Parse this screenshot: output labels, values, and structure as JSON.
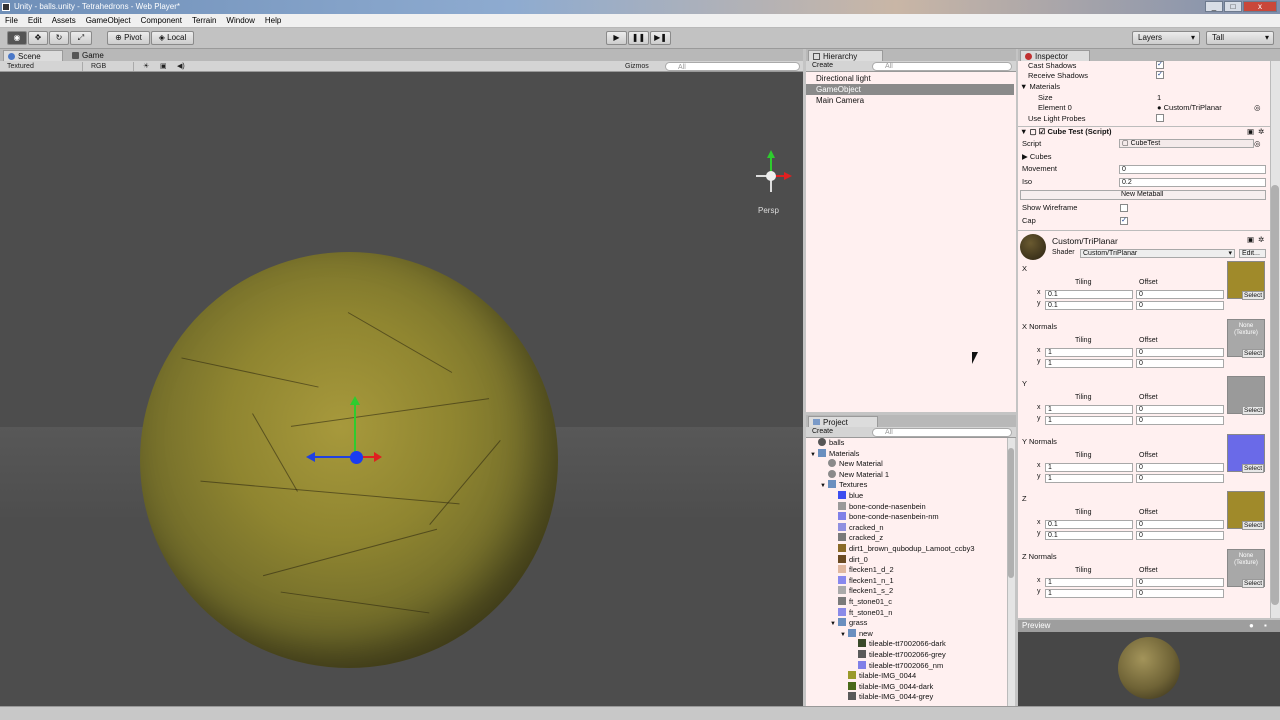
{
  "window": {
    "title": "Unity - balls.unity - Tetrahedrons - Web Player*"
  },
  "menu": [
    "File",
    "Edit",
    "Assets",
    "GameObject",
    "Component",
    "Terrain",
    "Window",
    "Help"
  ],
  "toolbar": {
    "pivot": "Pivot",
    "local": "Local",
    "layers": "Layers",
    "layout": "Tall"
  },
  "scene": {
    "tab_scene": "Scene",
    "tab_game": "Game",
    "render_mode": "Textured",
    "color_mode": "RGB",
    "gizmos": "Gizmos",
    "search": "All",
    "persp": "Persp"
  },
  "hierarchy": {
    "title": "Hierarchy",
    "create": "Create",
    "search": "All",
    "items": [
      "Directional light",
      "GameObject",
      "Main Camera"
    ],
    "selected_index": 1
  },
  "project": {
    "title": "Project",
    "create": "Create",
    "search": "All",
    "rows": [
      {
        "label": "balls",
        "indent": 0,
        "icon": "unity-scene-icon",
        "color": "#555555"
      },
      {
        "label": "Materials",
        "indent": 0,
        "icon": "folder-icon",
        "color": "#6a8fbf",
        "arrow": "▼"
      },
      {
        "label": "New Material",
        "indent": 1,
        "icon": "material-icon",
        "color": "#8a8a8a"
      },
      {
        "label": "New Material 1",
        "indent": 1,
        "icon": "material-icon",
        "color": "#8a8a8a"
      },
      {
        "label": "Textures",
        "indent": 1,
        "icon": "folder-icon",
        "color": "#6a8fbf",
        "arrow": "▼"
      },
      {
        "label": "blue",
        "indent": 2,
        "icon": "texture-icon",
        "color": "#3d4ef0"
      },
      {
        "label": "bone-conde-nasenbein",
        "indent": 2,
        "icon": "texture-icon",
        "color": "#9a9a9a"
      },
      {
        "label": "bone-conde-nasenbein-nm",
        "indent": 2,
        "icon": "texture-icon",
        "color": "#8080e8"
      },
      {
        "label": "cracked_n",
        "indent": 2,
        "icon": "texture-icon",
        "color": "#9090e0"
      },
      {
        "label": "cracked_z",
        "indent": 2,
        "icon": "texture-icon",
        "color": "#7a7a7a"
      },
      {
        "label": "dirt1_brown_qubodup_Lamoot_ccby3",
        "indent": 2,
        "icon": "texture-icon",
        "color": "#8a6a28"
      },
      {
        "label": "dirt_0",
        "indent": 2,
        "icon": "texture-icon",
        "color": "#6a4a22"
      },
      {
        "label": "flecken1_d_2",
        "indent": 2,
        "icon": "texture-icon",
        "color": "#e0b8a0"
      },
      {
        "label": "flecken1_n_1",
        "indent": 2,
        "icon": "texture-icon",
        "color": "#8888ee"
      },
      {
        "label": "flecken1_s_2",
        "indent": 2,
        "icon": "texture-icon",
        "color": "#aaaaaa"
      },
      {
        "label": "ft_stone01_c",
        "indent": 2,
        "icon": "texture-icon",
        "color": "#7a7a7a"
      },
      {
        "label": "ft_stone01_n",
        "indent": 2,
        "icon": "texture-icon",
        "color": "#8a8ae8"
      },
      {
        "label": "grass",
        "indent": 2,
        "icon": "folder-icon",
        "color": "#6a8fbf",
        "arrow": "▼"
      },
      {
        "label": "new",
        "indent": 3,
        "icon": "folder-icon",
        "color": "#6a8fbf",
        "arrow": "▼"
      },
      {
        "label": "tileable-tt7002066-dark",
        "indent": 4,
        "icon": "texture-icon",
        "color": "#3a4a2a"
      },
      {
        "label": "tileable-tt7002066-grey",
        "indent": 4,
        "icon": "texture-icon",
        "color": "#5a5a5a"
      },
      {
        "label": "tileable-tt7002066_nm",
        "indent": 4,
        "icon": "texture-icon",
        "color": "#8080e8"
      },
      {
        "label": "tilable-IMG_0044",
        "indent": 3,
        "icon": "texture-icon",
        "color": "#9a9a2a"
      },
      {
        "label": "tilable-IMG_0044-dark",
        "indent": 3,
        "icon": "texture-icon",
        "color": "#4a6a1a"
      },
      {
        "label": "tilable-IMG_0044-grey",
        "indent": 3,
        "icon": "texture-icon",
        "color": "#5a5a5a"
      }
    ]
  },
  "inspector": {
    "title": "Inspector",
    "cast_shadows": "Cast Shadows",
    "receive_shadows": "Receive Shadows",
    "materials": "Materials",
    "size_label": "Size",
    "size_value": "1",
    "element0_label": "Element 0",
    "element0_value": "Custom/TriPlanar",
    "use_light_probes": "Use Light Probes",
    "script_component": "Cube Test (Script)",
    "script_label": "Script",
    "script_value": "CubeTest",
    "cubes": "Cubes",
    "movement_label": "Movement",
    "movement_value": "0",
    "iso_label": "Iso",
    "iso_value": "0.2",
    "new_metaball": "New Metaball",
    "show_wireframe": "Show Wireframe",
    "cap": "Cap",
    "material_name": "Custom/TriPlanar",
    "shader_label": "Shader",
    "shader_value": "Custom/TriPlanar",
    "edit": "Edit...",
    "tiling": "Tiling",
    "offset": "Offset",
    "select": "Select",
    "none_texture": "None (Texture)",
    "sections": [
      {
        "name": "X",
        "tx": "0.1",
        "ty": "0.1",
        "ox": "0",
        "oy": "0",
        "tex": "#a08a2a",
        "none": false
      },
      {
        "name": "X Normals",
        "tx": "1",
        "ty": "1",
        "ox": "0",
        "oy": "0",
        "tex": "#a8a8a8",
        "none": true
      },
      {
        "name": "Y",
        "tx": "1",
        "ty": "1",
        "ox": "0",
        "oy": "0",
        "tex": "#9a9a9a",
        "none": false
      },
      {
        "name": "Y Normals",
        "tx": "1",
        "ty": "1",
        "ox": "0",
        "oy": "0",
        "tex": "#6a6ae8",
        "none": false
      },
      {
        "name": "Z",
        "tx": "0.1",
        "ty": "0.1",
        "ox": "0",
        "oy": "0",
        "tex": "#a08a2a",
        "none": false
      },
      {
        "name": "Z Normals",
        "tx": "1",
        "ty": "1",
        "ox": "0",
        "oy": "0",
        "tex": "#a8a8a8",
        "none": true
      }
    ]
  },
  "preview": {
    "title": "Preview"
  }
}
